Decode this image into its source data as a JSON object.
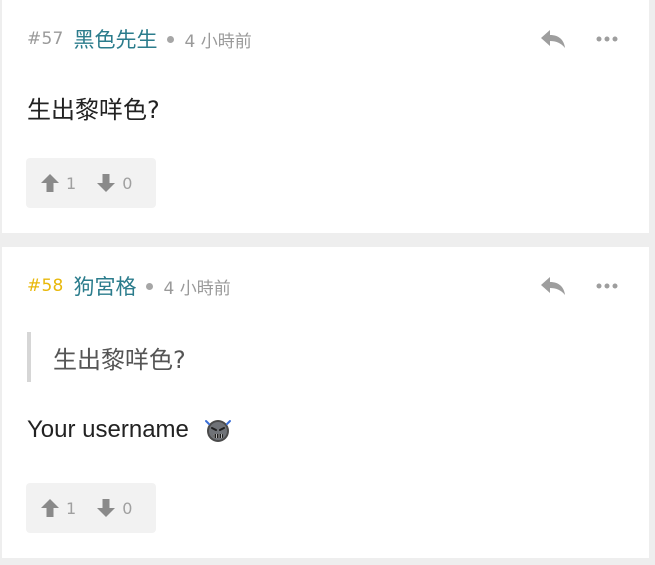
{
  "posts": [
    {
      "number": "#57",
      "username": "黑色先生",
      "time": "4 小時前",
      "body": "生出黎咩色?",
      "upvotes": "1",
      "downvotes": "0",
      "number_color": "#9a9a9a"
    },
    {
      "number": "#58",
      "username": "狗宮格",
      "time": "4 小時前",
      "quote": "生出黎咩色?",
      "body": "Your username",
      "emoji": "angry-face-icon",
      "upvotes": "1",
      "downvotes": "0",
      "number_color": "#e8b80b"
    }
  ],
  "colors": {
    "username": "#2b7c8c",
    "meta_gray": "#9a9a9a",
    "background": "#eeeeee"
  },
  "icons": [
    "reply-icon",
    "more-options-icon",
    "thumbs-up-arrow-icon",
    "thumbs-down-arrow-icon"
  ]
}
